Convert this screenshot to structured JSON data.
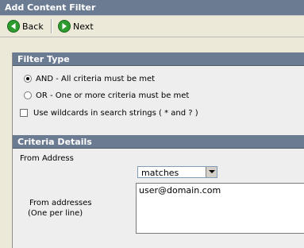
{
  "window": {
    "title": "Add Content Filter"
  },
  "toolbar": {
    "back_label": "Back",
    "next_label": "Next"
  },
  "filter_type": {
    "heading": "Filter Type",
    "options": [
      {
        "label": "AND - All criteria must be met",
        "selected": true
      },
      {
        "label": "OR - One or more criteria must be met",
        "selected": false
      }
    ],
    "wildcard_label": "Use wildcards in search strings ( * and ? )",
    "wildcard_checked": false
  },
  "criteria": {
    "heading": "Criteria Details",
    "from_address_label": "From Address",
    "match_select_value": "matches",
    "addresses_label_line1": "From addresses",
    "addresses_label_line2": "(One per line)",
    "addresses_value": "user@domain.com"
  },
  "colors": {
    "header_bg": "#6b7b92",
    "panel_bg": "#eeeeee",
    "window_bg": "#ece9d8"
  },
  "icons": {
    "back": "green-left-arrow-icon",
    "next": "green-right-arrow-icon"
  }
}
